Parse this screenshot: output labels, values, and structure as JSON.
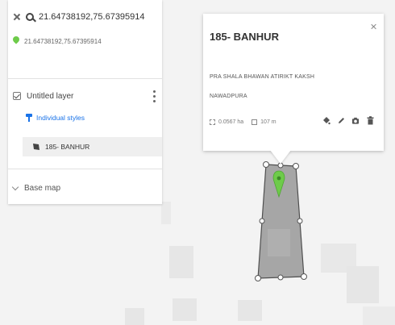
{
  "search": {
    "query": "21.64738192,75.67395914",
    "result": "21.64738192,75.67395914"
  },
  "layer": {
    "title": "Untitled layer",
    "styles_link": "Individual styles",
    "feature_label": "185- BANHUR"
  },
  "basemap": {
    "label": "Base map"
  },
  "popup": {
    "title": "185- BANHUR",
    "description_line1": "PRA SHALA BHAWAN ATIRIKT KAKSH",
    "description_line2": "NAWADPURA",
    "area": "0.0567 ha",
    "perimeter": "107 m"
  },
  "icons": {
    "close": "close-icon",
    "search": "search-icon",
    "pin": "location-pin-icon",
    "kebab": "kebab-menu-icon",
    "style": "paint-roller-icon",
    "polygon": "polygon-icon",
    "chevron": "chevron-down-icon",
    "paint": "paint-bucket-icon",
    "edit": "pencil-icon",
    "camera": "camera-icon",
    "delete": "trash-icon"
  },
  "colors": {
    "accent": "#1a73e8",
    "pin": "#6ecb4a",
    "polygon_fill": "#a6a6a6",
    "polygon_stroke": "#4f4f4f"
  }
}
